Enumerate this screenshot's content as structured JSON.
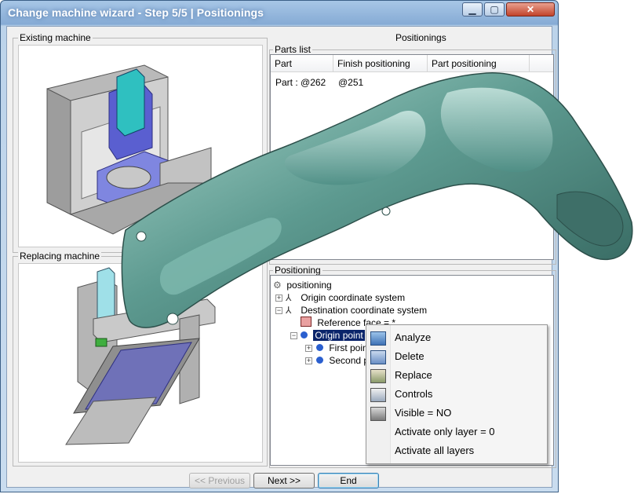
{
  "window": {
    "title": "Change machine wizard - Step 5/5 | Positionings",
    "controls": [
      "minimize",
      "maximize",
      "close"
    ]
  },
  "existing_machine": {
    "label": "Existing machine"
  },
  "replacing_machine": {
    "label": "Replacing machine"
  },
  "positionings": {
    "title": "Positionings",
    "parts_list": {
      "label": "Parts list",
      "columns": [
        "Part",
        "Finish positioning",
        "Part positioning"
      ],
      "rows": [
        {
          "part": "Part : @262",
          "finish": "@251",
          "part_pos": ""
        }
      ]
    },
    "tree": {
      "label": "Positioning",
      "nodes": {
        "root": "positioning",
        "origin_cs": "Origin coordinate system",
        "dest_cs": "Destination coordinate system",
        "ref_face": "Reference face = *",
        "origin_point": "Origin point",
        "first_point": "First point",
        "second_point": "Second point"
      }
    }
  },
  "context_menu": {
    "items": [
      {
        "label": "Analyze",
        "icon": "analyze-icon"
      },
      {
        "label": "Delete",
        "icon": "delete-icon"
      },
      {
        "label": "Replace",
        "icon": "replace-icon"
      },
      {
        "label": "Controls",
        "icon": "controls-icon"
      },
      {
        "label": "Visible = NO",
        "icon": "visible-icon"
      },
      {
        "label": "Activate only layer = 0",
        "icon": ""
      },
      {
        "label": "Activate all layers",
        "icon": ""
      }
    ]
  },
  "buttons": {
    "previous": "<< Previous",
    "next": "Next >>",
    "end": "End"
  },
  "colors": {
    "title_bar": "#8bb0d9",
    "selection": "#0a246a",
    "part": "#4f8f86",
    "machine_accent": "#5a5fd0",
    "machine_cyan": "#2fc0c0"
  }
}
